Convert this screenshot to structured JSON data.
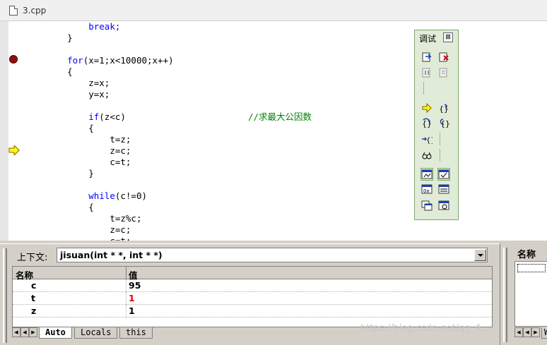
{
  "window": {
    "title": "3.cpp"
  },
  "editor": {
    "lines": [
      {
        "indent": "        ",
        "text": "break;",
        "kw": true
      },
      {
        "indent": "    ",
        "text": "}"
      },
      {
        "indent": "",
        "text": ""
      },
      {
        "indent": "    ",
        "text": "for(x=1;x<10000;x++)",
        "kw_prefix": "for"
      },
      {
        "indent": "    ",
        "text": "{"
      },
      {
        "indent": "        ",
        "text": "z=x;"
      },
      {
        "indent": "        ",
        "text": "y=x;"
      },
      {
        "indent": "",
        "text": ""
      },
      {
        "indent": "        ",
        "text": "if(z<c)",
        "kw_prefix": "if",
        "comment": "//求最大公因数"
      },
      {
        "indent": "        ",
        "text": "{"
      },
      {
        "indent": "            ",
        "text": "t=z;"
      },
      {
        "indent": "            ",
        "text": "z=c;"
      },
      {
        "indent": "            ",
        "text": "c=t;"
      },
      {
        "indent": "        ",
        "text": "}"
      },
      {
        "indent": "",
        "text": ""
      },
      {
        "indent": "        ",
        "text": "while(c!=0)",
        "kw_prefix": "while"
      },
      {
        "indent": "        ",
        "text": "{"
      },
      {
        "indent": "            ",
        "text": "t=z%c;"
      },
      {
        "indent": "            ",
        "text": "z=c;"
      },
      {
        "indent": "            ",
        "text": "c=t;"
      }
    ]
  },
  "debug_toolbar": {
    "title": "调试",
    "close_label": "⊠"
  },
  "context": {
    "label": "上下文:",
    "value": "jisuan(int * *, int * *)"
  },
  "variables": {
    "columns": [
      "名称",
      "值"
    ],
    "rows": [
      {
        "name": "c",
        "value": "95",
        "changed": false
      },
      {
        "name": "t",
        "value": "1",
        "changed": true
      },
      {
        "name": "z",
        "value": "1",
        "changed": false
      }
    ]
  },
  "tabs": [
    "Auto",
    "Locals",
    "this"
  ],
  "watch": {
    "header": "名称",
    "tab_partial": "W"
  },
  "watermark": "https://blog.csdn.net/qq_4..."
}
